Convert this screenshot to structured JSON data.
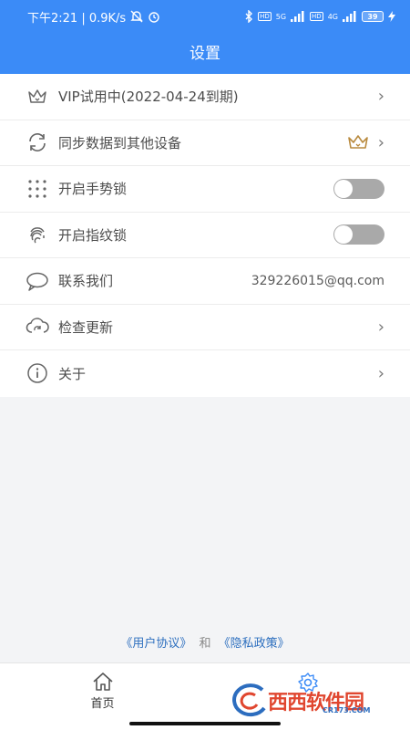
{
  "status_bar": {
    "time": "下午2:21 | 0.9K/s",
    "network_5g": "5G",
    "network_4g": "4G",
    "battery": "39"
  },
  "header": {
    "title": "设置"
  },
  "settings": {
    "vip": "VIP试用中(2022-04-24到期)",
    "sync": "同步数据到其他设备",
    "gesture_lock": "开启手势锁",
    "fingerprint_lock": "开启指纹锁",
    "contact": "联系我们",
    "contact_value": "329226015@qq.com",
    "update": "检查更新",
    "about": "关于",
    "gesture_lock_enabled": false,
    "fingerprint_lock_enabled": false
  },
  "footer": {
    "user_agreement": "《用户协议》",
    "and": "和",
    "privacy_policy": "《隐私政策》"
  },
  "tabbar": {
    "home": "首页",
    "settings_active": true
  },
  "watermark": {
    "brand": "西西软件园",
    "url": "CR173.COM"
  },
  "colors": {
    "primary": "#3b8bf7",
    "crown": "#b98a3e",
    "toggle_off": "#a9a9a9"
  }
}
